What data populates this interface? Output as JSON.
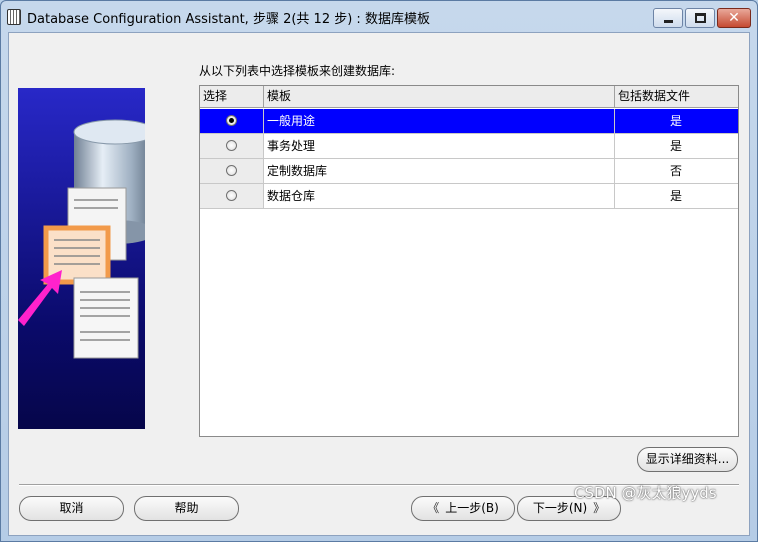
{
  "window": {
    "title": "Database Configuration Assistant, 步骤 2(共 12 步) : 数据库模板"
  },
  "main": {
    "prompt": "从以下列表中选择模板来创建数据库:",
    "table": {
      "headers": [
        "选择",
        "模板",
        "包括数据文件"
      ],
      "rows": [
        {
          "template": "一般用途",
          "include_datafiles": "是",
          "selected": true
        },
        {
          "template": "事务处理",
          "include_datafiles": "是",
          "selected": false
        },
        {
          "template": "定制数据库",
          "include_datafiles": "否",
          "selected": false
        },
        {
          "template": "数据仓库",
          "include_datafiles": "是",
          "selected": false
        }
      ]
    },
    "details_button": "显示详细资料..."
  },
  "footer": {
    "cancel": "取消",
    "help": "帮助",
    "back": "上一步(B)",
    "next": "下一步(N)"
  },
  "watermark": "CSDN @灰太狼yyds",
  "colors": {
    "selection": "#0000ff",
    "illustration": "#1a1aa8"
  }
}
